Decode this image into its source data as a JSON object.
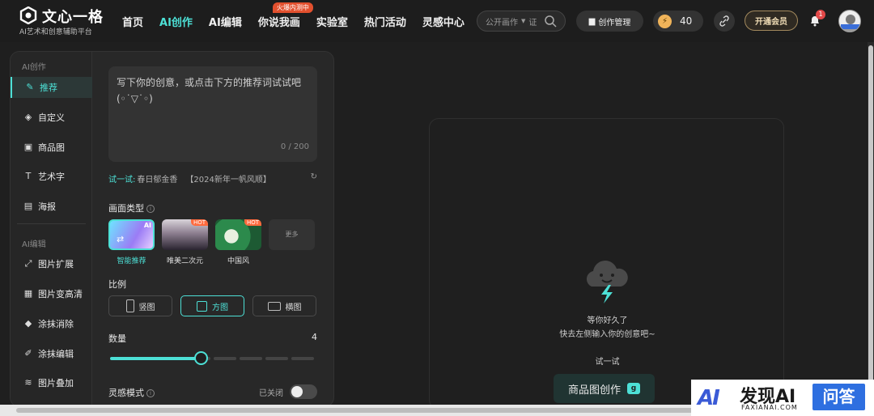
{
  "brand": {
    "name": "文心一格",
    "subtitle": "AI艺术和创意辅助平台"
  },
  "nav": [
    {
      "label": "首页",
      "active": false
    },
    {
      "label": "AI创作",
      "active": true
    },
    {
      "label": "AI编辑",
      "active": false
    },
    {
      "label": "你说我画",
      "active": false,
      "badge": "火爆内测中"
    },
    {
      "label": "实验室",
      "active": false
    },
    {
      "label": "热门活动",
      "active": false
    },
    {
      "label": "灵感中心",
      "active": false
    }
  ],
  "search": {
    "scope": "公开画作",
    "placeholder": "证"
  },
  "header": {
    "manage_label": "创作管理",
    "points": "40",
    "vip_label": "开通会员",
    "notify_count": "1"
  },
  "sidebar": {
    "section1": "AI创作",
    "items1": [
      {
        "label": "推荐",
        "icon": "brush-icon",
        "active": true
      },
      {
        "label": "自定义",
        "icon": "cube-icon",
        "active": false
      },
      {
        "label": "商品图",
        "icon": "image-icon",
        "active": false
      },
      {
        "label": "艺术字",
        "icon": "text-icon",
        "active": false
      },
      {
        "label": "海报",
        "icon": "poster-icon",
        "active": false
      }
    ],
    "section2": "AI编辑",
    "items2": [
      {
        "label": "图片扩展",
        "icon": "expand-icon"
      },
      {
        "label": "图片变高清",
        "icon": "hd-icon"
      },
      {
        "label": "涂抹消除",
        "icon": "eraser-icon"
      },
      {
        "label": "涂抹编辑",
        "icon": "edit-icon"
      },
      {
        "label": "图片叠加",
        "icon": "layers-icon"
      }
    ]
  },
  "prompt": {
    "placeholder": "写下你的创意，或点击下方的推荐词试试吧(◦˙▽˙◦)",
    "counter": "0 / 200"
  },
  "try": {
    "label": "试一试:",
    "s1": "春日郁金香",
    "s2": "【2024新年一帆风顺】"
  },
  "type": {
    "label": "画面类型",
    "items": [
      {
        "name": "智能推荐",
        "selected": true,
        "tag": "AI"
      },
      {
        "name": "唯美二次元",
        "selected": false,
        "tag": "HOT"
      },
      {
        "name": "中国风",
        "selected": false,
        "tag": "HOT"
      }
    ],
    "more": "更多"
  },
  "ratio": {
    "label": "比例",
    "items": [
      {
        "name": "竖图",
        "selected": false
      },
      {
        "name": "方图",
        "selected": true
      },
      {
        "name": "横图",
        "selected": false
      }
    ]
  },
  "quantity": {
    "label": "数量",
    "value": "4",
    "level": 4,
    "max": 9
  },
  "inspire": {
    "label": "灵感模式",
    "state": "已关闭"
  },
  "preview": {
    "line1": "等你好久了",
    "line2": "快去左侧输入你的创意吧~",
    "try": "试一试",
    "button": "商品图创作"
  },
  "watermark": {
    "brand": "AI",
    "name": "发现AI",
    "domain": "FAXIANAI.COM",
    "qa": "问答"
  },
  "colors": {
    "accent": "#4de0d6",
    "bg": "#1f1f1f",
    "panel": "#282828"
  }
}
